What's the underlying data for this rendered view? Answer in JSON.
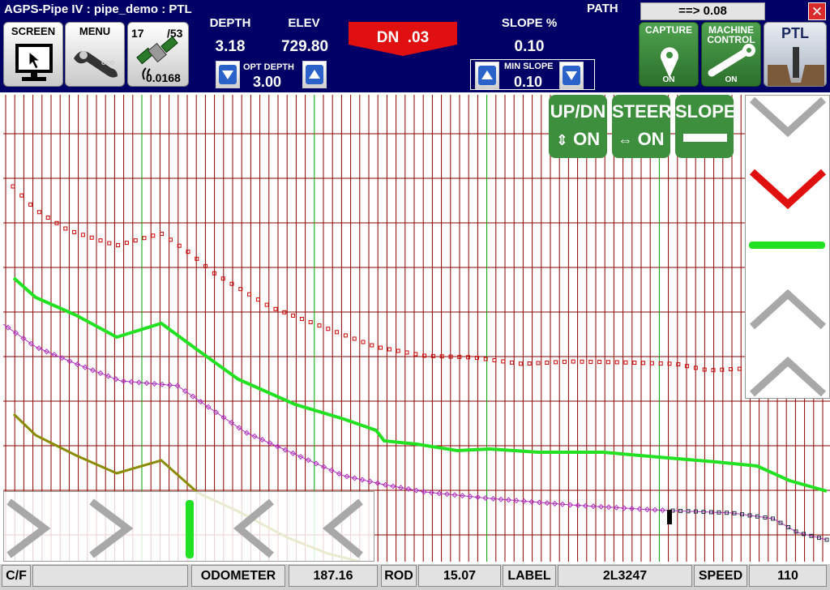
{
  "app": {
    "title": "AGPS-Pipe IV : pipe_demo : PTL",
    "close_glyph": "✕"
  },
  "toolbar": {
    "screen_label": "SCREEN",
    "menu_label": "MENU",
    "gps": {
      "sats": "17",
      "sats_total": "/53",
      "precision": "0.0168"
    }
  },
  "readouts": {
    "depth_label": "DEPTH",
    "depth_value": "3.18",
    "elev_label": "ELEV",
    "elev_value": "729.80",
    "opt_depth_label": "OPT DEPTH",
    "opt_depth_value": "3.00",
    "direction": "DN  .03",
    "slope_label": "SLOPE %",
    "slope_value": "0.10",
    "min_slope_label": "MIN SLOPE",
    "min_slope_value": "0.10",
    "path_label": "PATH",
    "path_value": "==> 0.08"
  },
  "controls": {
    "capture": {
      "label": "CAPTURE",
      "state": "ON"
    },
    "machine_control": {
      "label_line1": "MACHINE",
      "label_line2": "CONTROL",
      "state": "ON"
    },
    "ptl_label": "PTL"
  },
  "overlays": {
    "updn": {
      "label": "UP/DN",
      "state": "ON"
    },
    "steer": {
      "label": "STEER",
      "state": "ON"
    },
    "slope": {
      "label": "SLOPE"
    }
  },
  "status_bar": {
    "cf_label": "C/F",
    "odometer_label": "ODOMETER",
    "odometer_value": "187.16",
    "rod_label": "ROD",
    "rod_value": "15.07",
    "label_label": "LABEL",
    "label_value": "2L3247",
    "speed_label": "SPEED",
    "speed_value": "110"
  },
  "colors": {
    "header_bg": "#000066",
    "grid_red": "#8b0000",
    "grid_green": "#00a000",
    "profile_red": "#cc0000",
    "profile_green": "#22e022",
    "profile_magenta": "#b030c0",
    "profile_olive": "#8b8b00",
    "direction_red": "#e01010",
    "button_green": "#3d8e3d"
  }
}
